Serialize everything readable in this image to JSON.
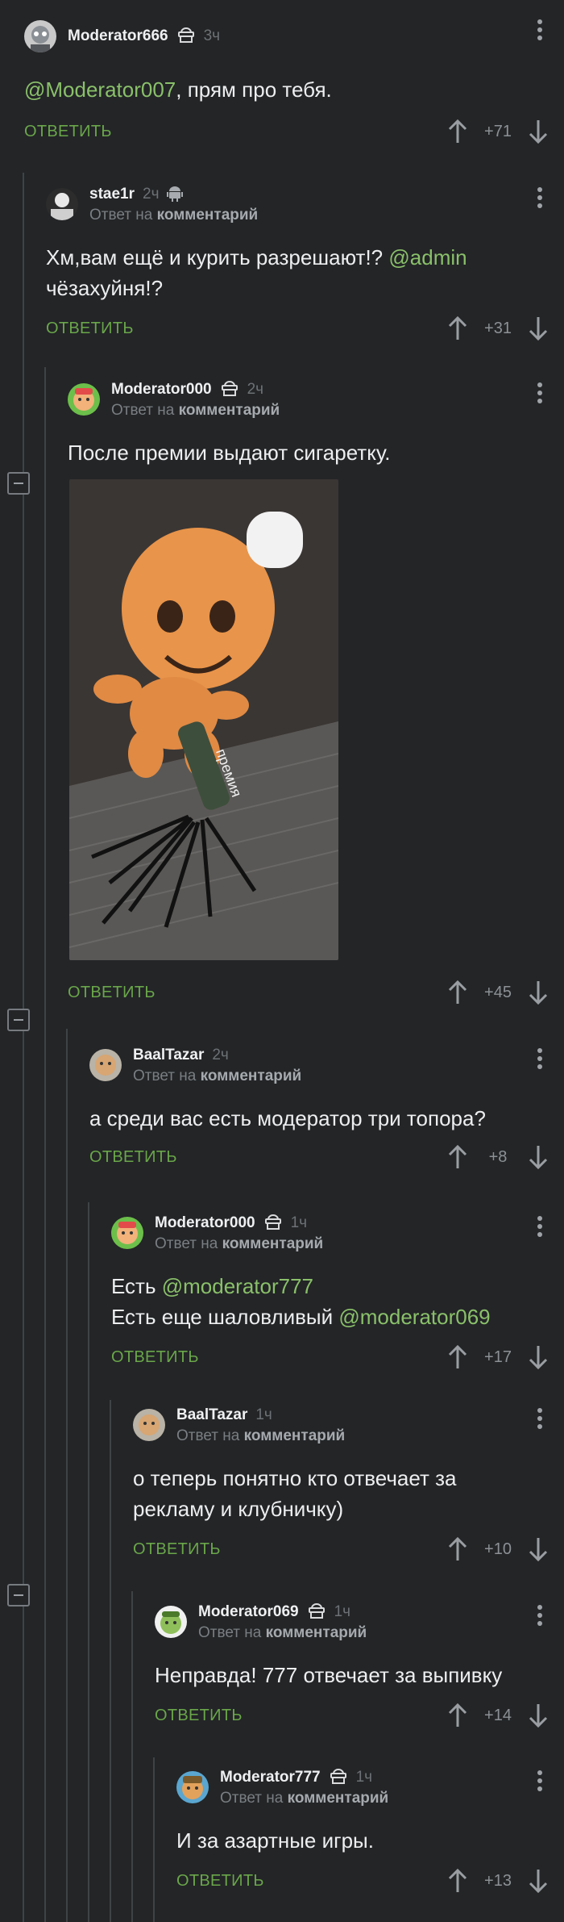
{
  "comments": [
    {
      "author": "Moderator666",
      "time": "3ч",
      "badge": "moderator",
      "reply_note": "",
      "reply_target": "",
      "text_pre": "",
      "mention": "@Moderator007",
      "text_post": ", прям про тебя.",
      "reply": "ОТВЕТИТЬ",
      "score": "+71"
    },
    {
      "author": "stae1r",
      "time": "2ч",
      "badge": "android",
      "reply_note": "Ответ на",
      "reply_target": "комментарий",
      "text_line1": "Хм,вам ещё и курить разрешают!? ",
      "mention": "@admin",
      "text_line2": "чёзахуйня!?",
      "reply": "ОТВЕТИТЬ",
      "score": "+31"
    },
    {
      "author": "Moderator000",
      "time": "2ч",
      "badge": "moderator",
      "reply_note": "Ответ на",
      "reply_target": "комментарий",
      "text": "После премии выдают сигаретку.",
      "image_caption": "премия",
      "reply": "ОТВЕТИТЬ",
      "score": "+45"
    },
    {
      "author": "BaalTazar",
      "time": "2ч",
      "badge": "",
      "reply_note": "Ответ на",
      "reply_target": "комментарий",
      "text": "а среди вас есть модератор три топора?",
      "reply": "ОТВЕТИТЬ",
      "score": "+8"
    },
    {
      "author": "Moderator000",
      "time": "1ч",
      "badge": "moderator",
      "reply_note": "Ответ на",
      "reply_target": "комментарий",
      "text_line1": "Есть ",
      "mention1": "@moderator777",
      "text_line2": "Есть еще шаловливый ",
      "mention2": "@moderator069",
      "reply": "ОТВЕТИТЬ",
      "score": "+17"
    },
    {
      "author": "BaalTazar",
      "time": "1ч",
      "badge": "",
      "reply_note": "Ответ на",
      "reply_target": "комментарий",
      "text_line1": "о теперь понятно кто отвечает за",
      "text_line2": "рекламу и клубничку)",
      "reply": "ОТВЕТИТЬ",
      "score": "+10"
    },
    {
      "author": "Moderator069",
      "time": "1ч",
      "badge": "moderator",
      "reply_note": "Ответ на",
      "reply_target": "комментарий",
      "text": "Неправда! 777 отвечает за выпивку",
      "reply": "ОТВЕТИТЬ",
      "score": "+14"
    },
    {
      "author": "Moderator777",
      "time": "1ч",
      "badge": "moderator",
      "reply_note": "Ответ на",
      "reply_target": "комментарий",
      "text": "И за азартные игры.",
      "reply": "ОТВЕТИТЬ",
      "score": "+13"
    }
  ],
  "colors": {
    "background": "#232527",
    "reply": "#6aa64a",
    "mention": "#8ac06a",
    "score": "#8d9195"
  },
  "icons": [
    "moderator-badge-icon",
    "android-icon",
    "arrow-up-icon",
    "arrow-down-icon",
    "more-vertical-icon",
    "collapse-thread-icon"
  ]
}
